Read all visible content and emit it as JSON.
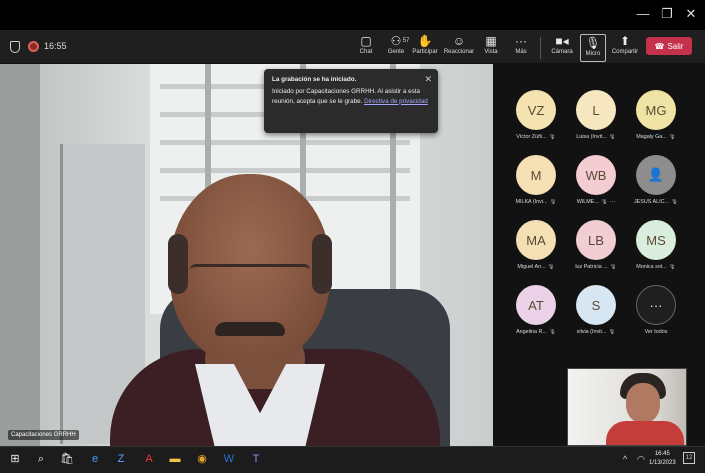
{
  "window": {
    "min": "—",
    "max": "❐",
    "close": "✕"
  },
  "meeting": {
    "timer": "16:55"
  },
  "toolbar": {
    "chat": {
      "label": "Chat",
      "icon": "chat-icon"
    },
    "gente": {
      "label": "Gente",
      "count": "57",
      "icon": "people-icon"
    },
    "participar": {
      "label": "Participar",
      "icon": "raise-hand-icon"
    },
    "reaccionar": {
      "label": "Reaccionar",
      "icon": "smile-icon"
    },
    "vista": {
      "label": "Vista",
      "icon": "view-icon"
    },
    "mas": {
      "label": "Más",
      "icon": "more-icon"
    },
    "camara": {
      "label": "Cámara",
      "icon": "camera-icon"
    },
    "micro": {
      "label": "Micro",
      "icon": "microphone-icon"
    },
    "compartir": {
      "label": "Compartir",
      "icon": "share-icon"
    },
    "leave": {
      "label": "Salir",
      "color": "#c4314b"
    }
  },
  "toast": {
    "title": "La grabación se ha iniciado.",
    "body": "Iniciado por Capacitaciones GRRHH. Al asistir a esta reunión, acepta que se le grabe.",
    "link": "Directiva de privacidad"
  },
  "stage": {
    "speaker_name": "Capacitaciones GRRHH"
  },
  "participants": [
    {
      "initials": "VZ",
      "label": "Víctor Zúñi...",
      "color": "#f4e3b0"
    },
    {
      "initials": "L",
      "label": "Luisa (Invit...",
      "color": "#f6e7c1"
    },
    {
      "initials": "MG",
      "label": "Magaly Ga...",
      "color": "#efe4a6"
    },
    {
      "initials": "M",
      "label": "MILKA (Invi...",
      "color": "#f5dfb4"
    },
    {
      "initials": "WB",
      "label": "WILME...",
      "color": "#f4cdd3"
    },
    {
      "initials": "",
      "label": "JESÚS ALIC...",
      "color": "#8d8d8d"
    },
    {
      "initials": "MA",
      "label": "Miguel An...",
      "color": "#f3e0b4"
    },
    {
      "initials": "LB",
      "label": "luz Patricia ...",
      "color": "#f2cdd3"
    },
    {
      "initials": "MS",
      "label": "Monica sot...",
      "color": "#d9eedd"
    },
    {
      "initials": "AT",
      "label": "Angelina R...",
      "color": "#ecd2e9"
    },
    {
      "initials": "S",
      "label": "silvia (Invit...",
      "color": "#d6e6f3"
    },
    {
      "initials": "···",
      "label": "Ver todos",
      "color": "#1f1f1f"
    }
  ],
  "taskbar": {
    "time": "16:45",
    "date": "1/13/2023",
    "notifications": "12"
  }
}
